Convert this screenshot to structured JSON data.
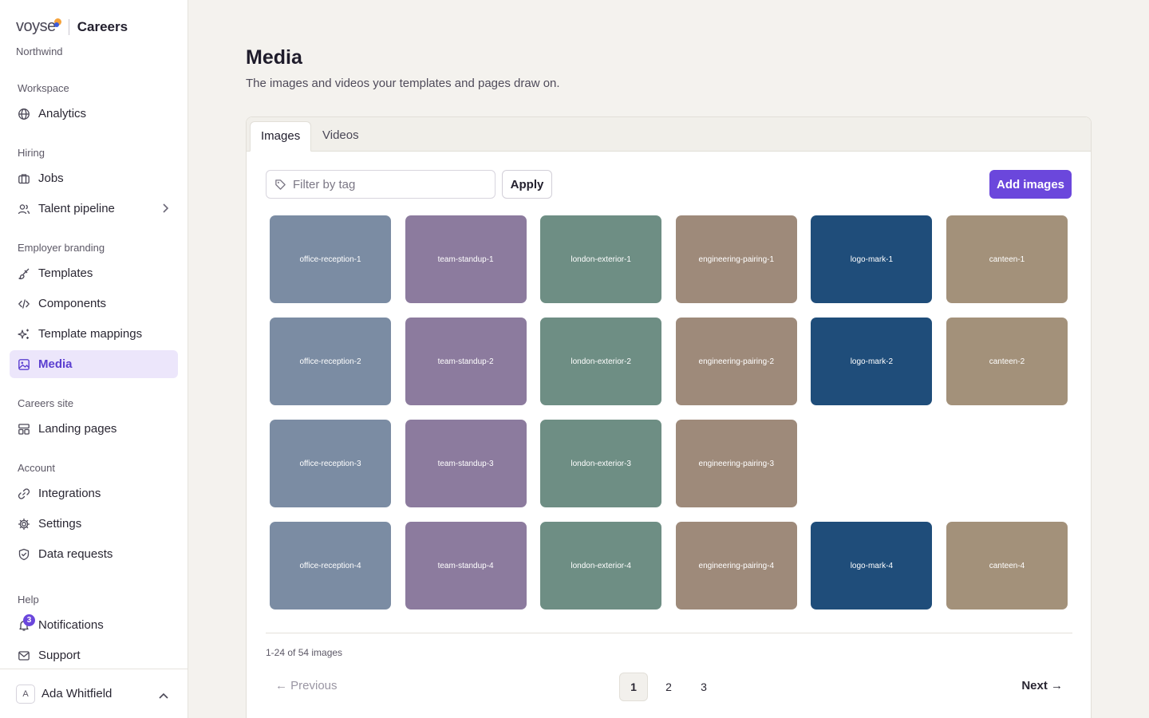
{
  "brand": {
    "logo": "voyse",
    "product": "Careers",
    "org": "Northwind"
  },
  "sidebar": {
    "sections": [
      {
        "title": "Workspace",
        "items": [
          {
            "label": "Analytics",
            "icon": "globe-icon"
          }
        ]
      },
      {
        "title": "Hiring",
        "items": [
          {
            "label": "Jobs",
            "icon": "briefcase-icon"
          },
          {
            "label": "Talent pipeline",
            "icon": "users-icon"
          }
        ]
      },
      {
        "title": "Employer branding",
        "items": [
          {
            "label": "Templates",
            "icon": "brush-icon"
          },
          {
            "label": "Components",
            "icon": "code-icon"
          },
          {
            "label": "Template mappings",
            "icon": "sparkle-icon"
          },
          {
            "label": "Media",
            "icon": "image-icon",
            "active": true
          }
        ]
      },
      {
        "title": "Careers site",
        "items": [
          {
            "label": "Landing pages",
            "icon": "layout-icon"
          }
        ]
      },
      {
        "title": "Account",
        "items": [
          {
            "label": "Integrations",
            "icon": "link-icon"
          },
          {
            "label": "Settings",
            "icon": "gear-icon"
          },
          {
            "label": "Data requests",
            "icon": "shield-icon"
          }
        ]
      },
      {
        "title": "Help",
        "items": [
          {
            "label": "Notifications",
            "icon": "bell-icon",
            "badge": "3"
          },
          {
            "label": "Support",
            "icon": "mail-icon"
          }
        ]
      }
    ],
    "user": {
      "initial": "A",
      "name": "Ada Whitfield"
    }
  },
  "page": {
    "title": "Media",
    "subtitle": "The images and videos your templates and pages draw on."
  },
  "tabs": [
    {
      "label": "Images",
      "active": true
    },
    {
      "label": "Videos"
    }
  ],
  "toolbar": {
    "filter_placeholder": "Filter by tag",
    "filter_value": "",
    "apply_label": "Apply",
    "add_label": "Add images"
  },
  "colors": {
    "office-reception": "#7b8ca3",
    "team-standup": "#8c7b9e",
    "london-exterior": "#6e8e84",
    "engineering-pairing": "#9e8a7a",
    "logo-mark": "#1f4d7a",
    "canteen": "#a3917a",
    "accent": "#6b47dc"
  },
  "media_rows": [
    [
      "office-reception-1",
      "team-standup-1",
      "london-exterior-1",
      "engineering-pairing-1",
      "logo-mark-1",
      "canteen-1"
    ],
    [
      "office-reception-2",
      "team-standup-2",
      "london-exterior-2",
      "engineering-pairing-2",
      "logo-mark-2",
      "canteen-2"
    ],
    [
      "office-reception-3",
      "team-standup-3",
      "london-exterior-3",
      "engineering-pairing-3"
    ],
    [
      "office-reception-4",
      "team-standup-4",
      "london-exterior-4",
      "engineering-pairing-4",
      "logo-mark-4",
      "canteen-4"
    ]
  ],
  "pagination": {
    "summary": "1-24 of 54 images",
    "previous": "← Previous",
    "next": "Next →",
    "pages": [
      "1",
      "2",
      "3"
    ],
    "current": "1"
  }
}
